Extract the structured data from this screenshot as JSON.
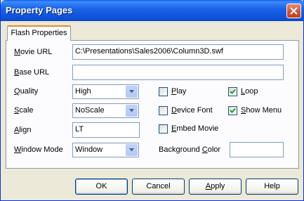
{
  "window": {
    "title": "Property Pages"
  },
  "tabs": [
    {
      "label": "Flash Properties"
    }
  ],
  "fields": {
    "movie_url": {
      "label_u": "M",
      "label_rest": "ovie URL",
      "value": "C:\\Presentations\\Sales2006\\Column3D.swf"
    },
    "base_url": {
      "label_u": "B",
      "label_rest": "ase URL",
      "value": ""
    },
    "quality": {
      "label_u": "Q",
      "label_rest": "uality",
      "value": "High"
    },
    "scale": {
      "label_u": "S",
      "label_rest": "cale",
      "value": "NoScale"
    },
    "align": {
      "label_u": "A",
      "label_rest": "lign",
      "value": "LT"
    },
    "window_mode": {
      "label_u": "W",
      "label_rest": "indow Mode",
      "value": "Window"
    },
    "background_color": {
      "label_pre": "Background ",
      "label_u": "C",
      "label_rest": "olor",
      "value": ""
    }
  },
  "checkboxes": {
    "play": {
      "label_u": "P",
      "label_rest": "lay",
      "checked": false
    },
    "loop": {
      "label_u": "L",
      "label_rest": "oop",
      "checked": true
    },
    "device_font": {
      "label_u": "D",
      "label_rest": "evice Font",
      "checked": false
    },
    "show_menu": {
      "label_u": "S",
      "label_rest": "how Menu",
      "checked": true
    },
    "embed_movie": {
      "label_u": "E",
      "label_rest": "mbed Movie",
      "checked": false
    }
  },
  "buttons": {
    "ok": "OK",
    "cancel": "Cancel",
    "apply_u": "A",
    "apply_rest": "pply",
    "help": "Help"
  },
  "colors": {
    "title_bar": "#0a5cf2",
    "close": "#d34f2c",
    "dialog_bg": "#ece9d8",
    "tab_accent": "#e68b2c"
  },
  "icons": {
    "close": "close-icon",
    "dropdown": "chevron-down-icon",
    "check": "check-icon"
  }
}
